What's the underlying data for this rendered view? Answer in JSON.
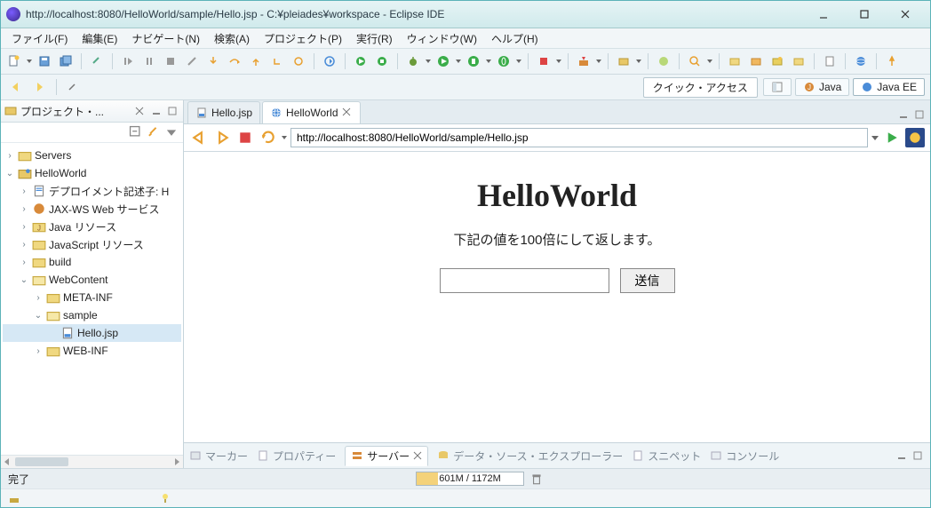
{
  "window": {
    "title": "http://localhost:8080/HelloWorld/sample/Hello.jsp - C:¥pleiades¥workspace - Eclipse IDE"
  },
  "menu": {
    "file": "ファイル(F)",
    "edit": "編集(E)",
    "navigate": "ナビゲート(N)",
    "search": "検索(A)",
    "project": "プロジェクト(P)",
    "run": "実行(R)",
    "window": "ウィンドウ(W)",
    "help": "ヘルプ(H)"
  },
  "quick_access": "クイック・アクセス",
  "perspectives": {
    "java": "Java",
    "javaee": "Java EE"
  },
  "project_explorer": {
    "title": "プロジェクト・...",
    "tree": {
      "servers": "Servers",
      "helloworld": "HelloWorld",
      "deployment": "デプロイメント記述子: H",
      "jaxws": "JAX-WS Web サービス",
      "javares": "Java リソース",
      "jsres": "JavaScript リソース",
      "build": "build",
      "webcontent": "WebContent",
      "metainf": "META-INF",
      "sample": "sample",
      "hellojsp": "Hello.jsp",
      "webinf": "WEB-INF"
    }
  },
  "editor_tabs": {
    "hello_jsp": "Hello.jsp",
    "helloworld": "HelloWorld"
  },
  "browser": {
    "url": "http://localhost:8080/HelloWorld/sample/Hello.jsp"
  },
  "page": {
    "heading": "HelloWorld",
    "desc": "下記の値を100倍にして返します。",
    "submit": "送信"
  },
  "bottom_views": {
    "markers": "マーカー",
    "properties": "プロパティー",
    "servers": "サーバー",
    "dse": "データ・ソース・エクスプローラー",
    "snippets": "スニペット",
    "console": "コンソール"
  },
  "status": {
    "done": "完了",
    "mem": "601M / 1172M"
  }
}
